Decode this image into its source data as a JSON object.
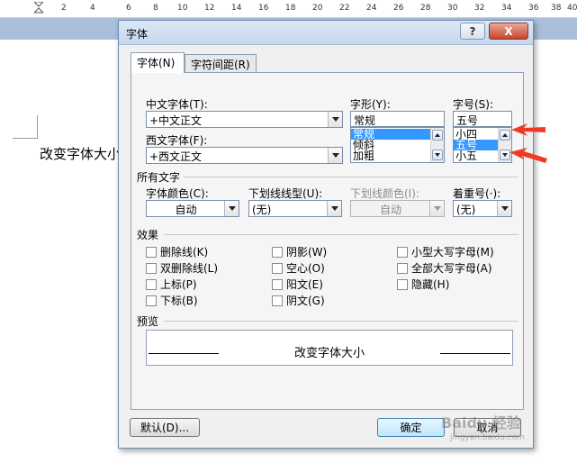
{
  "ruler": {
    "numbers": [
      "2",
      "4",
      "6",
      "8",
      "10",
      "12",
      "14",
      "16",
      "18",
      "20",
      "22",
      "24",
      "26",
      "28",
      "30",
      "32",
      "34",
      "36",
      "38",
      "40"
    ]
  },
  "document": {
    "body_text": "改变字体大小"
  },
  "dialog": {
    "title": "字体",
    "help_button": "?",
    "close_button": "X",
    "tabs": [
      {
        "label": "字体(N)",
        "selected": true
      },
      {
        "label": "字符间距(R)",
        "selected": false
      }
    ],
    "chinese_font": {
      "label": "中文字体(T):",
      "value": "+中文正文"
    },
    "western_font": {
      "label": "西文字体(F):",
      "value": "+西文正文"
    },
    "style": {
      "label": "字形(Y):",
      "value": "常规",
      "options": [
        "常规",
        "倾斜",
        "加粗"
      ],
      "selected_index": 0
    },
    "size": {
      "label": "字号(S):",
      "value": "五号",
      "options": [
        "小四",
        "五号",
        "小五"
      ],
      "selected_index": 1
    },
    "all_text": {
      "heading": "所有文字",
      "font_color": {
        "label": "字体颜色(C):",
        "value": "自动"
      },
      "underline_style": {
        "label": "下划线线型(U):",
        "value": "(无)"
      },
      "underline_color": {
        "label": "下划线颜色(I):",
        "value": "自动",
        "disabled": true
      },
      "emphasis_mark": {
        "label": "着重号(·):",
        "value": "(无)"
      }
    },
    "effects": {
      "heading": "效果",
      "options": [
        {
          "label": "删除线(K)",
          "checked": false
        },
        {
          "label": "双删除线(L)",
          "checked": false
        },
        {
          "label": "上标(P)",
          "checked": false
        },
        {
          "label": "下标(B)",
          "checked": false
        },
        {
          "label": "阴影(W)",
          "checked": false
        },
        {
          "label": "空心(O)",
          "checked": false
        },
        {
          "label": "阳文(E)",
          "checked": false
        },
        {
          "label": "阴文(G)",
          "checked": false
        },
        {
          "label": "小型大写字母(M)",
          "checked": false
        },
        {
          "label": "全部大写字母(A)",
          "checked": false
        },
        {
          "label": "隐藏(H)",
          "checked": false
        }
      ]
    },
    "preview": {
      "heading": "预览",
      "text": "改变字体大小"
    },
    "buttons": {
      "default": "默认(D)...",
      "ok": "确定",
      "cancel": "取消"
    }
  },
  "annotation": {
    "arrow_color": "#f03a26"
  },
  "watermark": {
    "main": "Baidu 经验",
    "sub": "jingyan.baidu.com"
  },
  "colors": {
    "selection": "#3399ff",
    "dialog_bg": "#f0f0f0",
    "titlebar": "#c6d8ee",
    "close_button": "#c7432c",
    "ruler_band": "#a9bfdb"
  }
}
